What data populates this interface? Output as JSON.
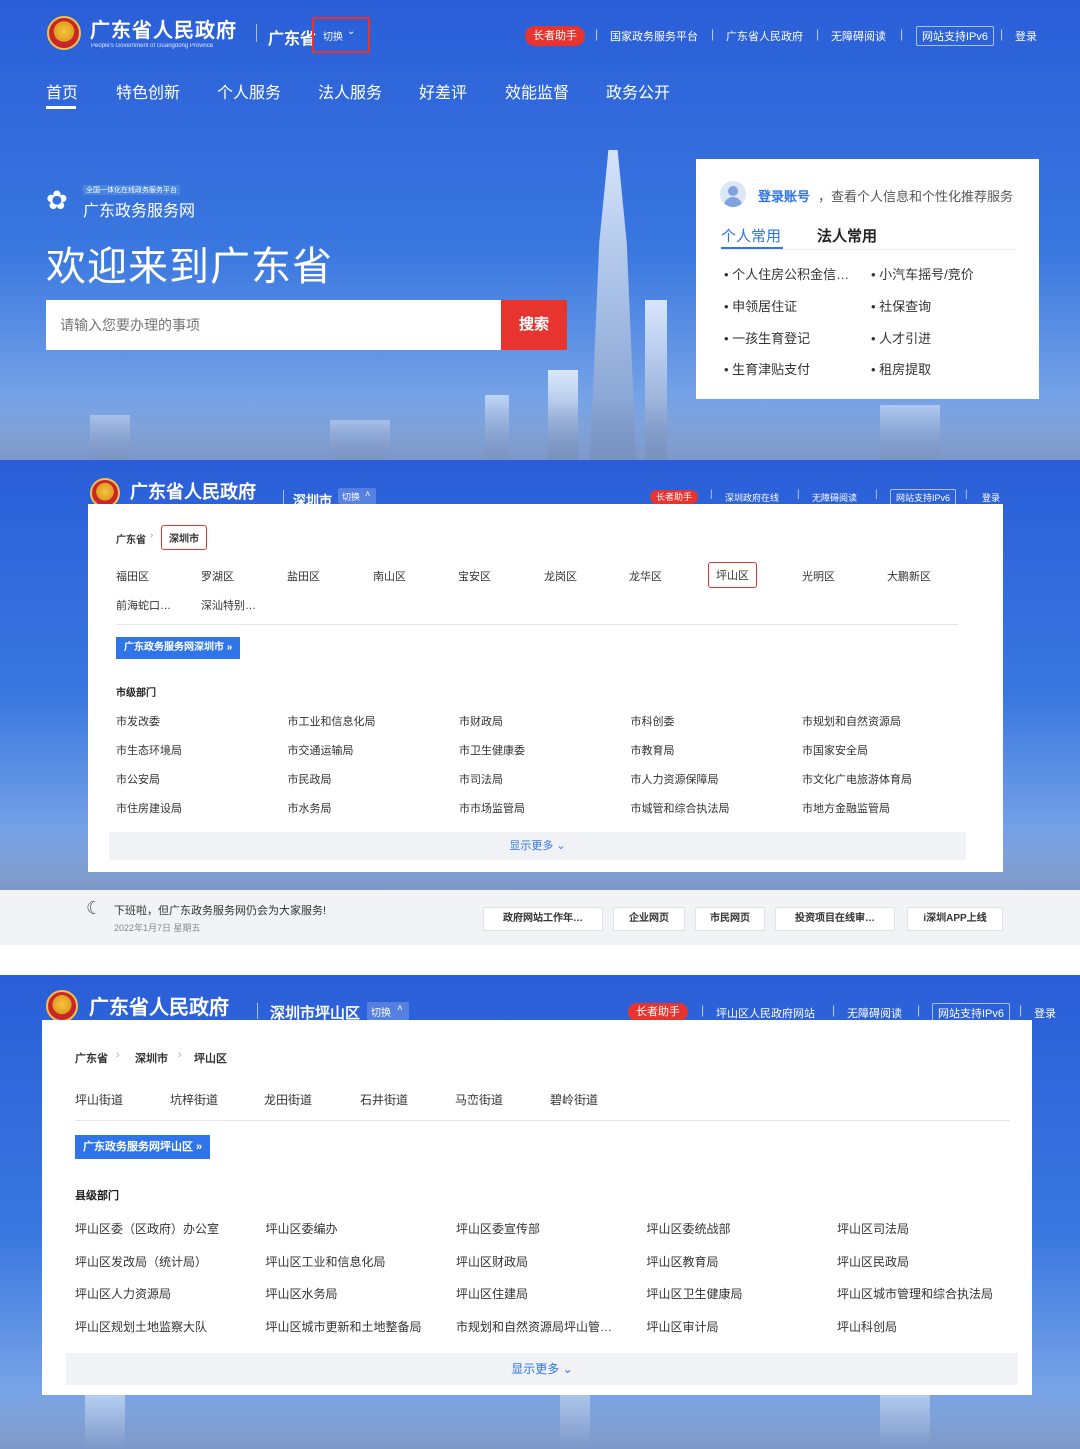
{
  "s1": {
    "brand": "广东省人民政府",
    "brand_en": "People's Government of Guangdong Province",
    "region": "广东省",
    "switch": "切换",
    "elder": "长者助手",
    "links": [
      "国家政务服务平台",
      "广东省人民政府",
      "无障碍阅读",
      "网站支持IPv6",
      "登录"
    ],
    "nav": [
      "首页",
      "特色创新",
      "个人服务",
      "法人服务",
      "好差评",
      "效能监督",
      "政务公开"
    ],
    "logo_small": "全国一体化在线政务服务平台",
    "logo_name": "广东政务服务网",
    "welcome": "欢迎来到广东省",
    "search_placeholder": "请输入您要办理的事项",
    "search_btn": "搜索",
    "card": {
      "login_link": "登录账号",
      "login_tip": "，查看个人信息和个性化推荐服务",
      "tabs": [
        "个人常用",
        "法人常用"
      ],
      "items": [
        "个人住房公积金信…",
        "小汽车摇号/竞价",
        "申领居住证",
        "社保查询",
        "一孩生育登记",
        "人才引进",
        "生育津贴支付",
        "租房提取"
      ]
    }
  },
  "s2": {
    "brand": "广东省人民政府",
    "region": "深圳市",
    "switch": "切换",
    "elder": "长者助手",
    "links": [
      "深圳政府在线",
      "无障碍阅读",
      "网站支持IPv6",
      "登录"
    ],
    "crumb": [
      "广东省",
      "深圳市"
    ],
    "districts": [
      "福田区",
      "罗湖区",
      "盐田区",
      "南山区",
      "宝安区",
      "龙岗区",
      "龙华区",
      "坪山区",
      "光明区",
      "大鹏新区",
      "前海蛇口…",
      "深汕特别…"
    ],
    "portal_btn": "广东政务服务网深圳市 »",
    "dept_title": "市级部门",
    "depts": [
      "市发改委",
      "市工业和信息化局",
      "市财政局",
      "市科创委",
      "市规划和自然资源局",
      "市生态环境局",
      "市交通运输局",
      "市卫生健康委",
      "市教育局",
      "市国家安全局",
      "市公安局",
      "市民政局",
      "市司法局",
      "市人力资源保障局",
      "市文化广电旅游体育局",
      "市住房建设局",
      "市水务局",
      "市市场监管局",
      "市城管和综合执法局",
      "市地方金融监管局"
    ],
    "more": "显示更多",
    "notice": "下班啦，但广东政务服务网仍会为大家服务!",
    "date": "2022年1月7日 星期五",
    "quick": [
      "政府网站工作年…",
      "企业网页",
      "市民网页",
      "投资项目在线审…",
      "i深圳APP上线"
    ]
  },
  "s3": {
    "brand": "广东省人民政府",
    "region": "深圳市坪山区",
    "switch": "切换",
    "elder": "长者助手",
    "links": [
      "坪山区人民政府网站",
      "无障碍阅读",
      "网站支持IPv6",
      "登录"
    ],
    "crumb": [
      "广东省",
      "深圳市",
      "坪山区"
    ],
    "streets": [
      "坪山街道",
      "坑梓街道",
      "龙田街道",
      "石井街道",
      "马峦街道",
      "碧岭街道"
    ],
    "portal_btn": "广东政务服务网坪山区 »",
    "dept_title": "县级部门",
    "depts": [
      "坪山区委（区政府）办公室",
      "坪山区委编办",
      "坪山区委宣传部",
      "坪山区委统战部",
      "坪山区司法局",
      "坪山区发改局（统计局）",
      "坪山区工业和信息化局",
      "坪山区财政局",
      "坪山区教育局",
      "坪山区民政局",
      "坪山区人力资源局",
      "坪山区水务局",
      "坪山区住建局",
      "坪山区卫生健康局",
      "坪山区城市管理和综合执法局",
      "坪山区规划土地监察大队",
      "坪山区城市更新和土地整备局",
      "市规划和自然资源局坪山管…",
      "坪山区审计局",
      "坪山科创局"
    ],
    "more": "显示更多"
  }
}
